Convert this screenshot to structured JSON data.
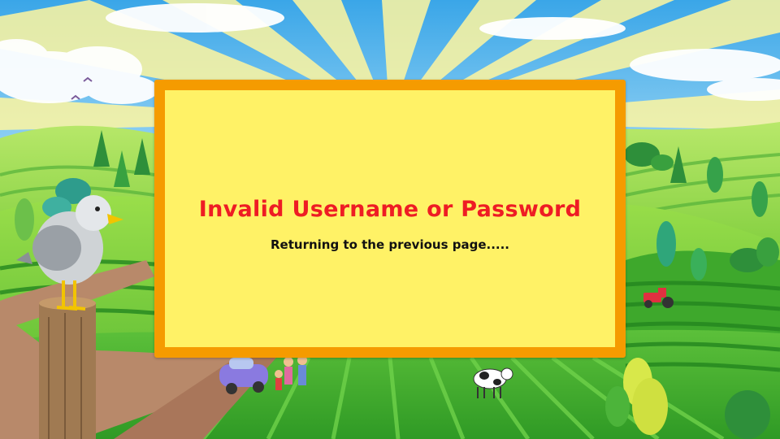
{
  "dialog": {
    "title": "Invalid Username or Password",
    "message": "Returning to the previous page....."
  },
  "colors": {
    "dialog_background": "#fff266",
    "dialog_border": "#f59b00",
    "title_text": "#ee1c24",
    "message_text": "#111111",
    "sky": "#4fb3ea",
    "sun_rays": "#fff8a8",
    "hills": "#7fd13b",
    "crop_rows": "#2e9e2a",
    "dirt_road": "#b58a6b"
  },
  "scene_elements": [
    "seagull",
    "wooden-post",
    "purple-car",
    "family",
    "cow",
    "red-tractor",
    "farm-hills"
  ]
}
